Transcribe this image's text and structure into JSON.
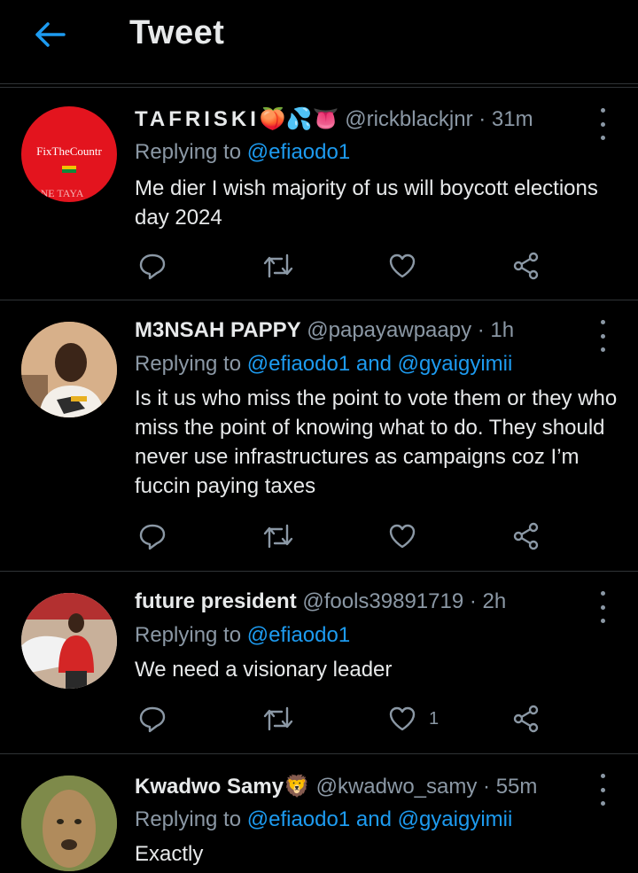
{
  "header": {
    "title": "Tweet"
  },
  "tweets": [
    {
      "display_name": "TAFRISKI",
      "display_emoji": "🍑💦👅",
      "handle_time": "@rickblackjnr · 31m",
      "replying_prefix": "Replying to ",
      "replying_to": "@efiaodo1",
      "replying_and": "",
      "replying_to_2": "",
      "text": "Me dier I wish majority of us will boycott elections day 2024",
      "like_count": "",
      "avatar_text": "FixTheCountr",
      "avatar_text_2": "NE TAYA"
    },
    {
      "display_name": "M3NSAH PAPPY",
      "display_emoji": "",
      "handle_time": "@papayawpaapy · 1h",
      "replying_prefix": "Replying to ",
      "replying_to": "@efiaodo1",
      "replying_and": " and ",
      "replying_to_2": "@gyaigyimii",
      "text": "Is it us who miss the point to vote them or they who miss the point of knowing what to do. They should never use infrastructures as campaigns coz I’m fuccin paying taxes",
      "like_count": ""
    },
    {
      "display_name": "future president",
      "display_emoji": "",
      "handle_time": "@fools39891719 · 2h",
      "replying_prefix": "Replying to ",
      "replying_to": "@efiaodo1",
      "replying_and": "",
      "replying_to_2": "",
      "text": "We need a visionary leader",
      "like_count": "1"
    },
    {
      "display_name": "Kwadwo Samy",
      "display_emoji": "🦁",
      "handle_time": "@kwadwo_samy · 55m",
      "replying_prefix": "Replying to ",
      "replying_to": "@efiaodo1",
      "replying_and": " and ",
      "replying_to_2": "@gyaigyimii",
      "text": "Exactly",
      "like_count": ""
    }
  ],
  "colors": {
    "background": "#000000",
    "accent": "#1d9bf0",
    "muted": "#8b98a5",
    "divider": "#2f3336"
  }
}
